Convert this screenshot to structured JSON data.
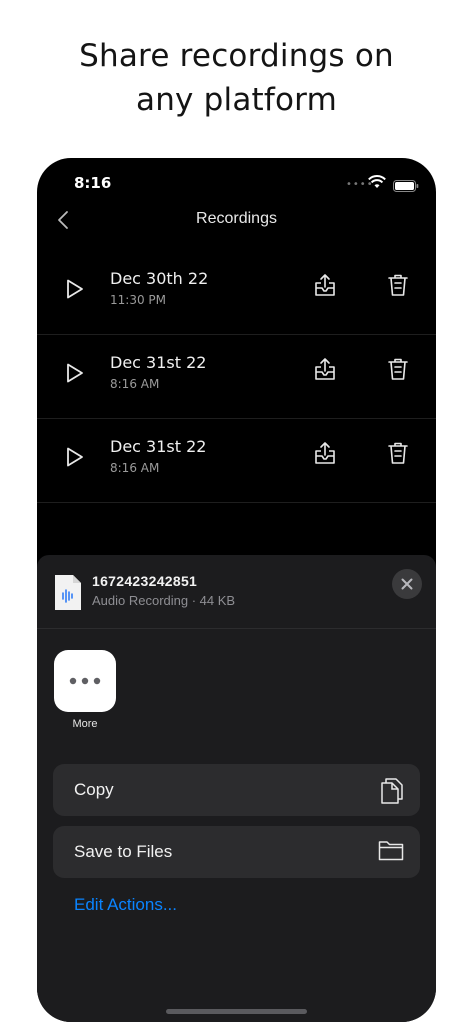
{
  "headline": {
    "line1": "Share recordings on",
    "line2": "any platform"
  },
  "status_bar": {
    "time": "8:16",
    "signal_dots": "••••",
    "icons": [
      "wifi-icon",
      "battery-icon"
    ]
  },
  "nav": {
    "back_icon": "chevron-left-icon",
    "title": "Recordings"
  },
  "recordings": [
    {
      "name": "Dec 30th 22",
      "time": "11:30 PM"
    },
    {
      "name": "Dec 31st 22",
      "time": "8:16 AM"
    },
    {
      "name": "Dec 31st 22",
      "time": "8:16 AM"
    }
  ],
  "share_sheet": {
    "file_name": "1672423242851",
    "file_meta": "Audio Recording · 44 KB",
    "more_label": "More",
    "actions": [
      {
        "label": "Copy",
        "icon": "copy-icon"
      },
      {
        "label": "Save to Files",
        "icon": "folder-icon"
      }
    ],
    "edit_actions_label": "Edit Actions...",
    "accent_color": "#0a84ff"
  }
}
